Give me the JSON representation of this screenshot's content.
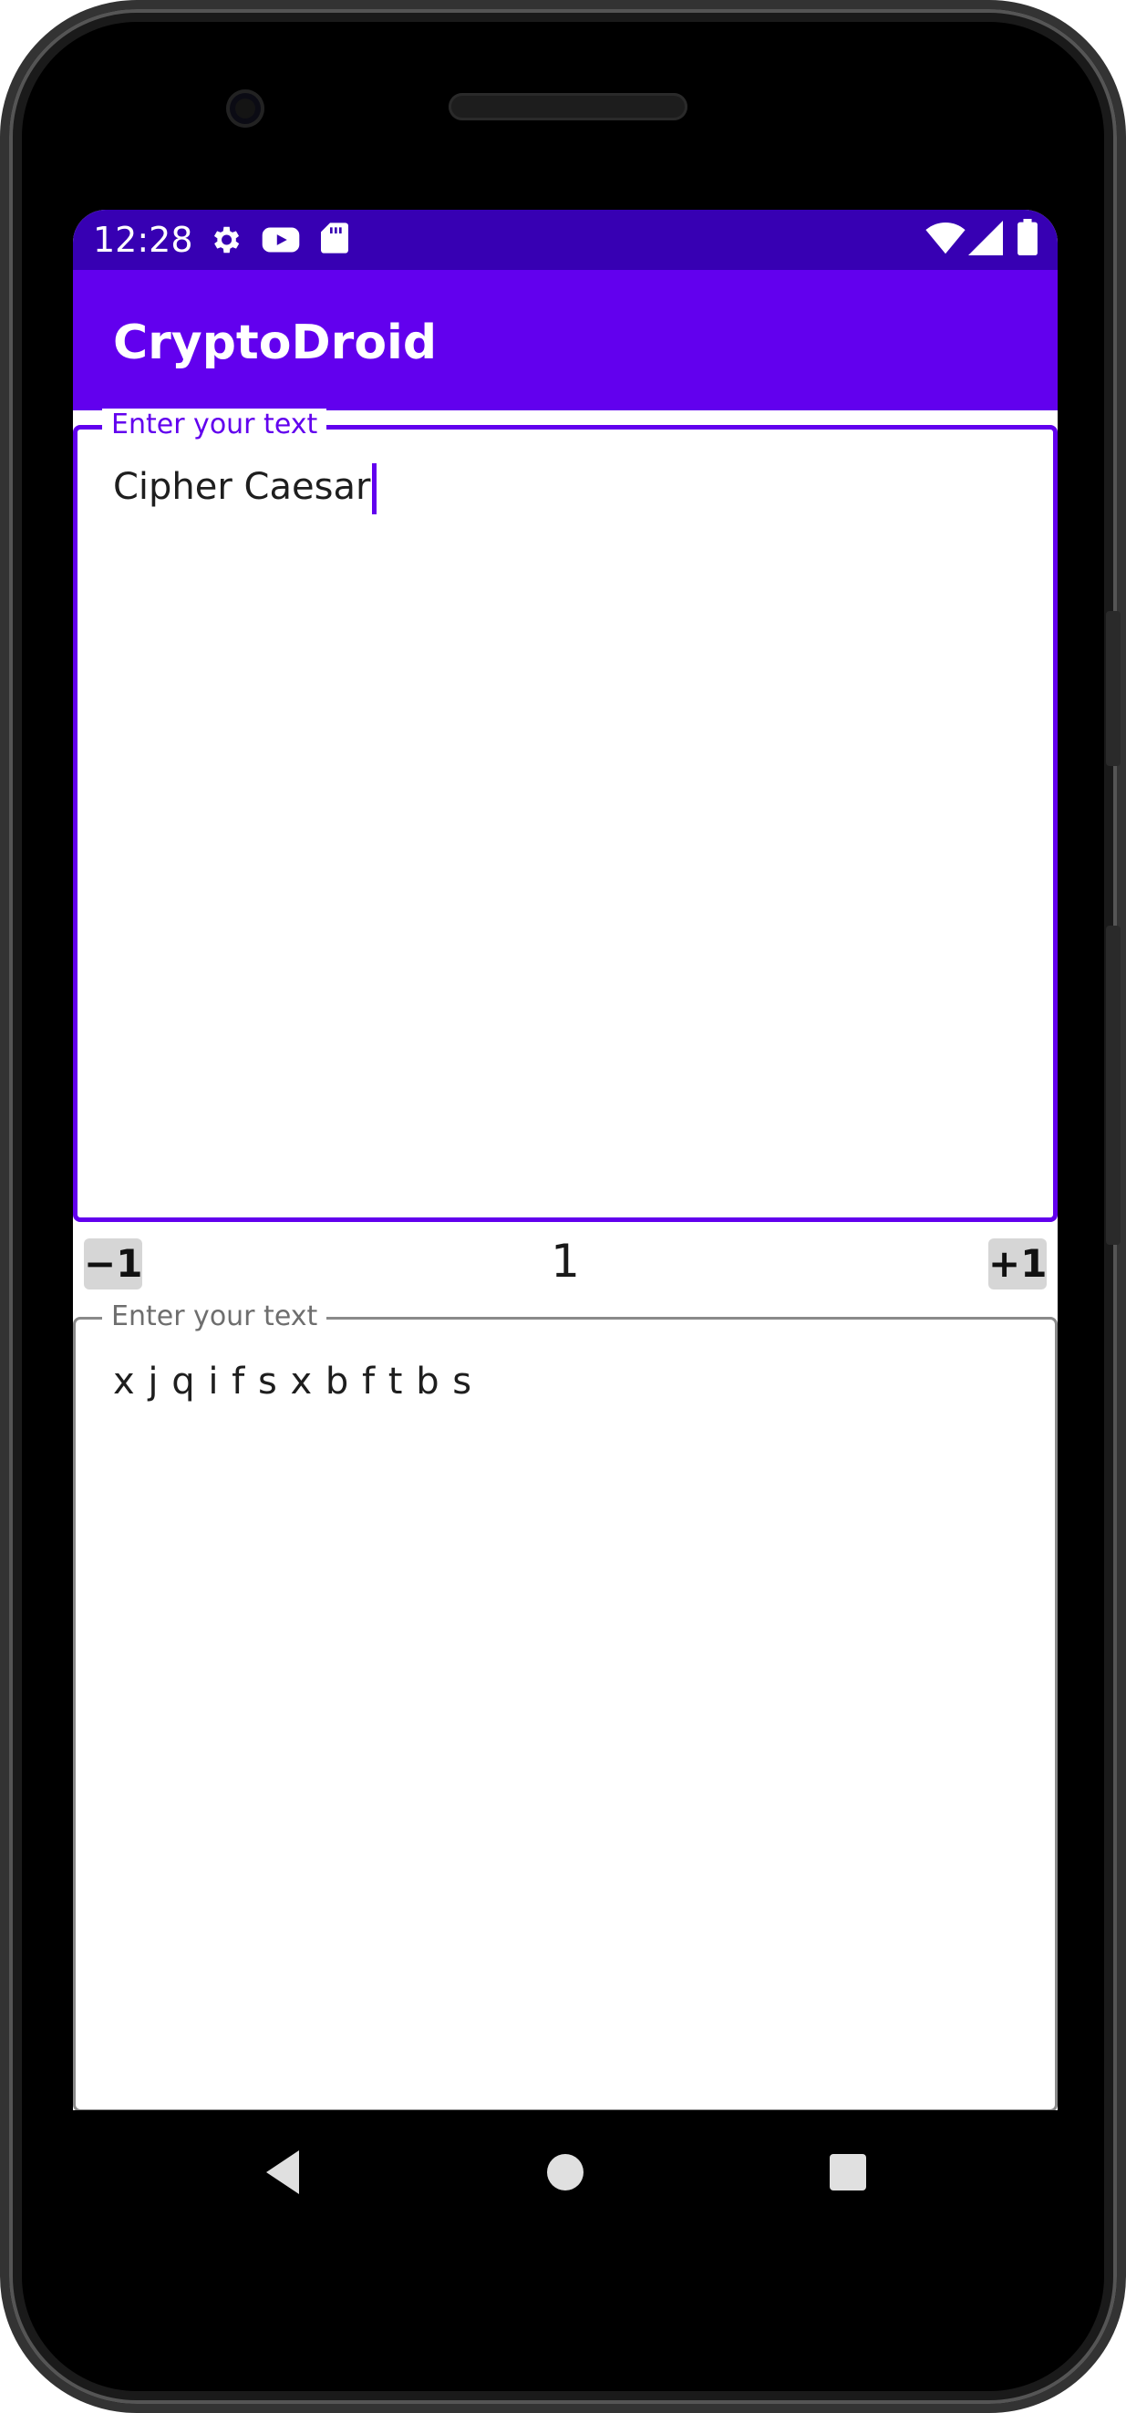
{
  "status_bar": {
    "time": "12:28",
    "icons": [
      "gear-icon",
      "youtube-icon",
      "sd-card-icon",
      "wifi-icon",
      "signal-icon",
      "battery-icon"
    ]
  },
  "app_bar": {
    "title": "CryptoDroid"
  },
  "input_field": {
    "label": "Enter your text",
    "value": "Cipher Caesar"
  },
  "shift_controls": {
    "decrement_label": "−1",
    "value": "1",
    "increment_label": "+1"
  },
  "output_field": {
    "label": "Enter your text",
    "value": "x j q i f s x b f t b s"
  },
  "nav_bar": {
    "buttons": [
      "back-icon",
      "home-icon",
      "recents-icon"
    ]
  },
  "colors": {
    "primary": "#6200ee",
    "primary_dark": "#3700b3",
    "outline_inactive": "#8a8a8a",
    "button_bg": "#d6d6d6"
  }
}
